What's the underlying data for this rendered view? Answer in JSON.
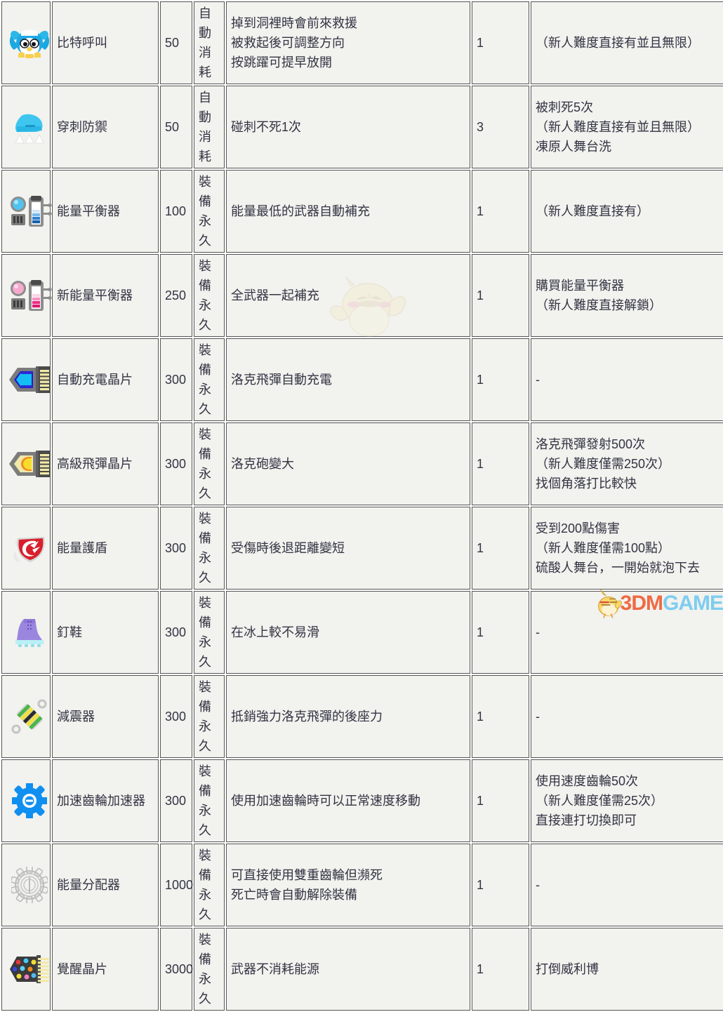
{
  "table": {
    "columns": [
      "icon",
      "name",
      "price",
      "type",
      "effect",
      "quantity",
      "unlock_note"
    ],
    "colors": {
      "row_bg": "#f2f2ee",
      "row_highlight_bg": "#e0e0e0",
      "border": "#555555",
      "text": "#333344"
    },
    "rows": [
      {
        "icon": "bit-call-penguin-icon",
        "name": "比特呼叫",
        "price": "50",
        "type": "自動\n消耗",
        "effect": "掉到洞裡時會前來救援\n被救起後可調整方向\n按跳躍可提早放開",
        "quantity": "1",
        "note": "（新人難度直接有並且無限）",
        "highlight": false
      },
      {
        "icon": "spike-guard-shoe-icon",
        "name": "穿刺防禦",
        "price": "50",
        "type": "自動\n消耗",
        "effect": "碰刺不死1次",
        "quantity": "3",
        "note": "被刺死5次\n（新人難度直接有並且無限）\n凍原人舞台洗",
        "highlight": false
      },
      {
        "icon": "energy-balancer-blue-icon",
        "name": "能量平衡器",
        "price": "100",
        "type": "裝備\n永久",
        "effect": "能量最低的武器自動補充",
        "quantity": "1",
        "note": "（新人難度直接有）",
        "highlight": false
      },
      {
        "icon": "energy-balancer-pink-icon",
        "name": "新能量平衡器",
        "price": "250",
        "type": "裝備\n永久",
        "effect": "全武器一起補充",
        "quantity": "1",
        "note": "購買能量平衡器\n（新人難度直接解鎖）",
        "highlight": false
      },
      {
        "icon": "auto-charge-chip-blue-icon",
        "name": "自動充電晶片",
        "price": "300",
        "type": "裝備\n永久",
        "effect": "洛克飛彈自動充電",
        "quantity": "1",
        "note": "-",
        "highlight": true
      },
      {
        "icon": "advanced-buster-chip-yellow-icon",
        "name": "高級飛彈晶片",
        "price": "300",
        "type": "裝備\n永久",
        "effect": "洛克砲變大",
        "quantity": "1",
        "note": "洛克飛彈發射500次\n（新人難度僅需250次）\n找個角落打比較快",
        "highlight": false
      },
      {
        "icon": "energy-shield-icon",
        "name": "能量護盾",
        "price": "300",
        "type": "裝備\n永久",
        "effect": "受傷時後退距離變短",
        "quantity": "1",
        "note": "受到200點傷害\n（新人難度僅需100點）\n硫酸人舞台，一開始就泡下去",
        "highlight": false
      },
      {
        "icon": "spike-boots-icon",
        "name": "釘鞋",
        "price": "300",
        "type": "裝備\n永久",
        "effect": "在冰上較不易滑",
        "quantity": "1",
        "note": "-",
        "highlight": false
      },
      {
        "icon": "shock-absorber-icon",
        "name": "減震器",
        "price": "300",
        "type": "裝備\n永久",
        "effect": "抵銷強力洛克飛彈的後座力",
        "quantity": "1",
        "note": "-",
        "highlight": false
      },
      {
        "icon": "speed-gear-accelerator-icon",
        "name": "加速齒輪加速器",
        "price": "300",
        "type": "裝備\n永久",
        "effect": "使用加速齒輪時可以正常速度移動",
        "quantity": "1",
        "note": "使用速度齒輪50次\n（新人難度僅需25次）\n直接連打切換即可",
        "highlight": false
      },
      {
        "icon": "energy-distributor-icon",
        "name": "能量分配器",
        "price": "1000",
        "type": "裝備\n永久",
        "effect": "可直接使用雙重齒輪但瀕死\n死亡時會自動解除裝備",
        "quantity": "1",
        "note": "-",
        "highlight": false
      },
      {
        "icon": "awakening-chip-icon",
        "name": "覺醒晶片",
        "price": "3000",
        "type": "裝備\n永久",
        "effect": "武器不消耗能源",
        "quantity": "1",
        "note": "打倒威利博",
        "highlight": false
      }
    ]
  },
  "watermarks": {
    "bird": "bird-mascot-watermark",
    "brand_primary": "3DM",
    "brand_secondary": "GAME",
    "brand_colors": {
      "primary": "#ef6a44",
      "secondary": "#7ecdf0"
    }
  }
}
